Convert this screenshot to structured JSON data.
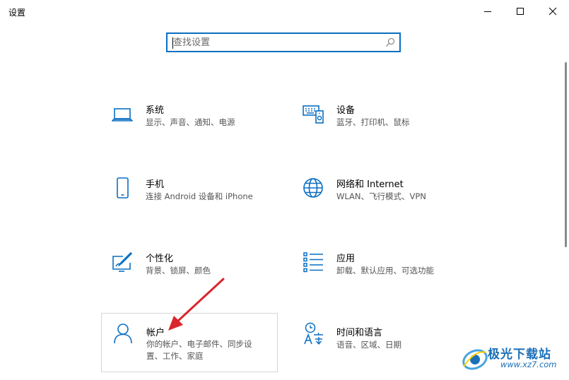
{
  "window": {
    "title": "设置"
  },
  "search": {
    "placeholder": "查找设置"
  },
  "tiles": [
    {
      "title": "系统",
      "desc": "显示、声音、通知、电源",
      "icon": "laptop-icon"
    },
    {
      "title": "设备",
      "desc": "蓝牙、打印机、鼠标",
      "icon": "devices-icon"
    },
    {
      "title": "手机",
      "desc": "连接 Android 设备和 iPhone",
      "icon": "phone-icon"
    },
    {
      "title": "网络和 Internet",
      "desc": "WLAN、飞行模式、VPN",
      "icon": "globe-icon"
    },
    {
      "title": "个性化",
      "desc": "背景、锁屏、颜色",
      "icon": "personalization-icon"
    },
    {
      "title": "应用",
      "desc": "卸载、默认应用、可选功能",
      "icon": "apps-list-icon"
    },
    {
      "title": "帐户",
      "desc": "你的帐户、电子邮件、同步设置、工作、家庭",
      "icon": "person-icon"
    },
    {
      "title": "时间和语言",
      "desc": "语音、区域、日期",
      "icon": "time-language-icon"
    }
  ],
  "watermark": {
    "name": "极光下载站",
    "url": "www.xz7.com"
  },
  "colors": {
    "accent": "#0a6fc2",
    "arrow": "#d9262c"
  }
}
